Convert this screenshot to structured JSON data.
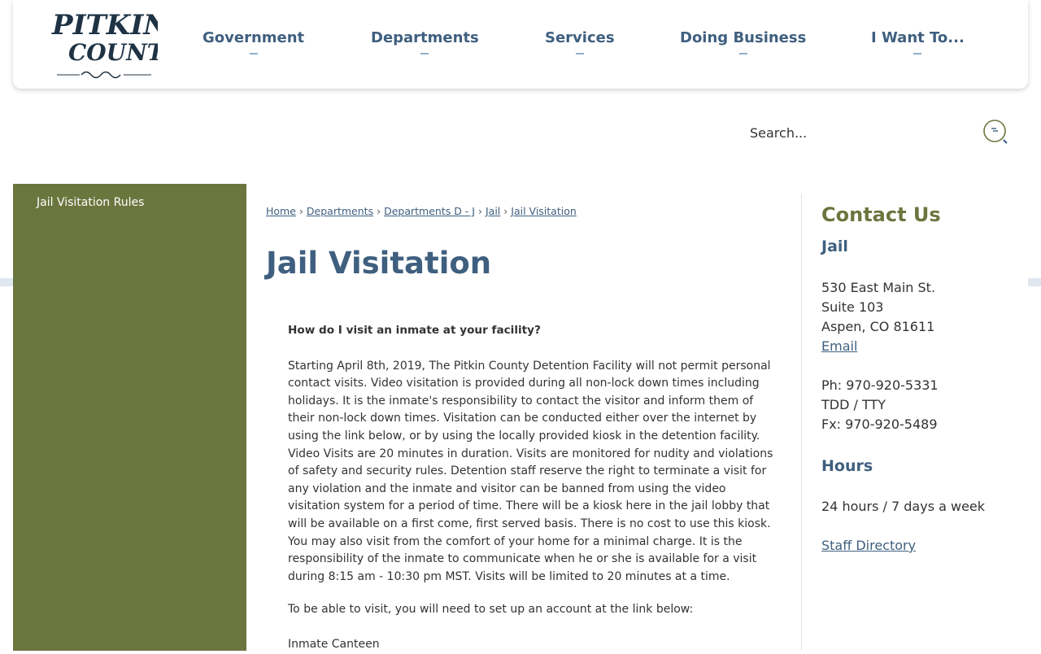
{
  "logo": {
    "line1": "PITKIN",
    "line2": "COUNTY"
  },
  "nav": [
    {
      "label": "Government"
    },
    {
      "label": "Departments"
    },
    {
      "label": "Services"
    },
    {
      "label": "Doing Business"
    },
    {
      "label": "I Want To..."
    }
  ],
  "search": {
    "placeholder": "Search..."
  },
  "sidebar": {
    "items": [
      {
        "label": "Jail Visitation Rules"
      }
    ]
  },
  "breadcrumb": [
    {
      "label": "Home"
    },
    {
      "label": "Departments"
    },
    {
      "label": "Departments D - J"
    },
    {
      "label": "Jail"
    },
    {
      "label": "Jail Visitation"
    }
  ],
  "breadcrumb_separator": "›",
  "page": {
    "title": "Jail Visitation",
    "question": "How do I visit an inmate at your facility?",
    "paragraph1": "Starting April 8th, 2019, The Pitkin County Detention Facility will not permit personal contact visits.  Video visitation is provided during all non-lock down times including holidays.  It is the inmate's responsibility to contact the visitor and inform them of their non-lock down times.  Visitation can be conducted either over the internet by using the link below, or by using the locally provided kiosk in the detention facility.  Video Visits are 20 minutes in duration.  Visits are monitored for nudity and violations of safety and security rules.  Detention staff reserve the right to terminate a visit for any violation and the inmate and visitor can be banned from using the video visitation system for a period of time.  There will be a kiosk here in the jail lobby that will be available on a first come, first served basis.  There is no cost to use this kiosk.  You may also visit from the comfort of your home for a minimal charge.  It is the responsibility of the inmate to communicate when he or she is available for a visit during 8:15 am - 10:30 pm MST.  Visits will be limited to 20 minutes at a time.",
    "paragraph2": "To be able to visit, you will need to set up an account at the link below:",
    "paragraph3": "Inmate Canteen"
  },
  "contact": {
    "title": "Contact Us",
    "department": "Jail",
    "address_line1": "530 East Main St.",
    "address_line2": "Suite 103",
    "address_line3": "Aspen, CO  81611",
    "email_label": "Email",
    "phone": "Ph: 970-920-5331",
    "tdd": "TDD / TTY",
    "fax": "Fx: 970-920-5489",
    "hours_title": "Hours",
    "hours": "24 hours / 7 days a week",
    "staff_directory": "Staff Directory"
  },
  "colors": {
    "nav_blue": "#3f5f7f",
    "sidebar_olive": "#6b763e",
    "band": "#dfe7ef"
  },
  "icons": {
    "search": "search-icon"
  }
}
